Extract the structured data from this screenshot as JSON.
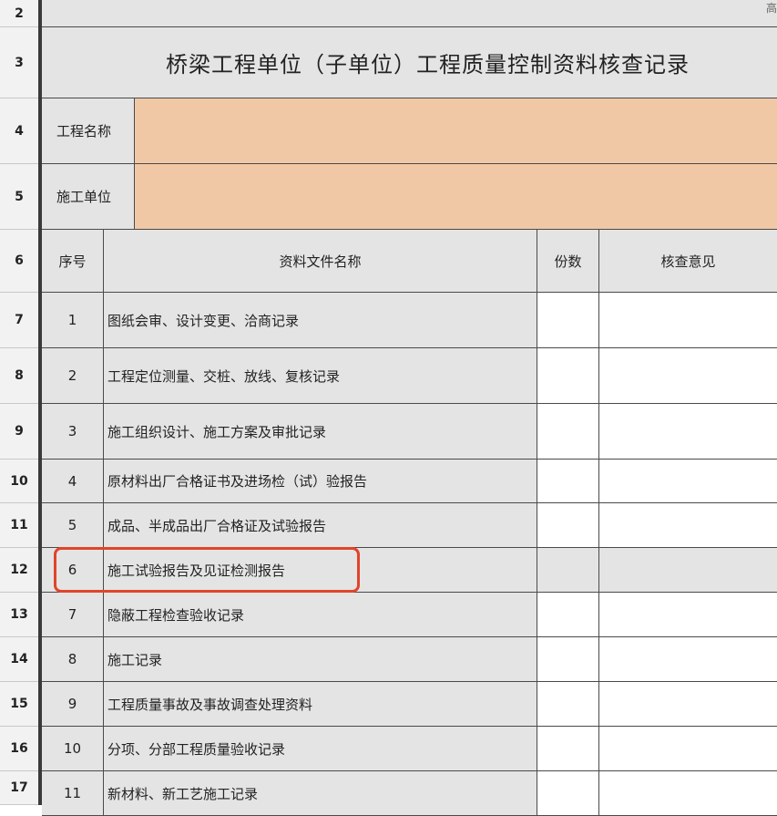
{
  "row_headers": [
    "2",
    "3",
    "4",
    "5",
    "6",
    "7",
    "8",
    "9",
    "10",
    "11",
    "12",
    "13",
    "14",
    "15",
    "16",
    "17"
  ],
  "title": "桥梁工程单位（子单位）工程质量控制资料核查记录",
  "corner_text": "高",
  "project_name_label": "工程名称",
  "project_name_value": "",
  "contractor_label": "施工单位",
  "contractor_value": "",
  "table_header": {
    "index": "序号",
    "doc_name": "资料文件名称",
    "copies": "份数",
    "review": "核查意见"
  },
  "items": [
    {
      "no": "1",
      "name": "图纸会审、设计变更、洽商记录"
    },
    {
      "no": "2",
      "name": "工程定位测量、交桩、放线、复核记录"
    },
    {
      "no": "3",
      "name": "施工组织设计、施工方案及审批记录"
    },
    {
      "no": "4",
      "name": "原材料出厂合格证书及进场检（试）验报告"
    },
    {
      "no": "5",
      "name": "成品、半成品出厂合格证及试验报告"
    },
    {
      "no": "6",
      "name": "施工试验报告及见证检测报告"
    },
    {
      "no": "7",
      "name": "隐蔽工程检查验收记录"
    },
    {
      "no": "8",
      "name": "施工记录"
    },
    {
      "no": "9",
      "name": "工程质量事故及事故调查处理资料"
    },
    {
      "no": "10",
      "name": "分项、分部工程质量验收记录"
    },
    {
      "no": "11",
      "name": "新材料、新工艺施工记录"
    }
  ],
  "colors": {
    "header_fill": "#e4e4e4",
    "input_fill": "#f1c8a6",
    "highlight": "#e0452a"
  }
}
